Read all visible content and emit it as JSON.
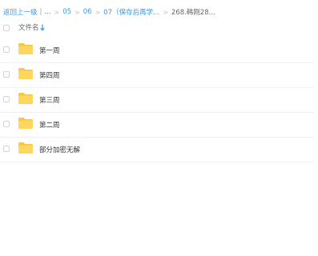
{
  "breadcrumb": {
    "back_label": "返回上一级",
    "divider": "|",
    "ellipsis": "...",
    "separator": ">",
    "items": [
      "05",
      "06",
      "07（保存后再学..."
    ],
    "current": "268.韩刚28..."
  },
  "header": {
    "name_column": "文件名",
    "sort_icon": "arrow-down-icon"
  },
  "files": [
    {
      "name": "第一周",
      "icon": "folder-icon"
    },
    {
      "name": "第四周",
      "icon": "folder-icon"
    },
    {
      "name": "第三周",
      "icon": "folder-icon"
    },
    {
      "name": "第二周",
      "icon": "folder-icon"
    },
    {
      "name": "部分加密无解",
      "icon": "folder-icon"
    }
  ],
  "colors": {
    "link": "#3a9ae6",
    "folder_back": "#f9c640",
    "folder_front": "#ffd75e"
  }
}
